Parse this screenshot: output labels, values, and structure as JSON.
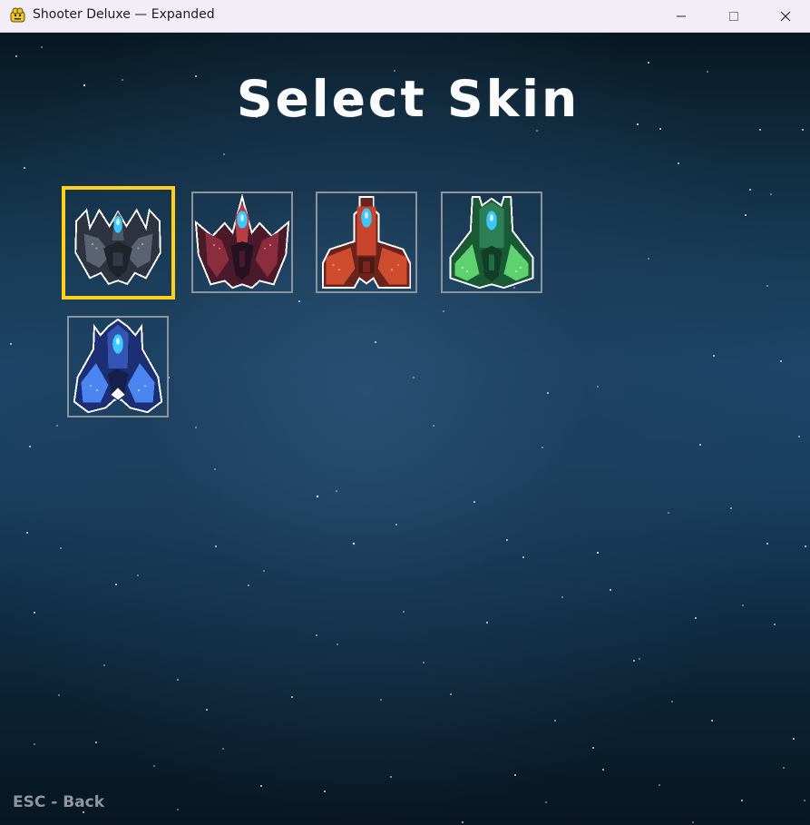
{
  "window": {
    "title": "Shooter Deluxe — Expanded",
    "app_icon": "pygame-snake-icon",
    "controls": {
      "minimize_icon": "minimize-icon",
      "maximize_icon": "maximize-icon",
      "close_icon": "close-icon"
    }
  },
  "screen": {
    "heading": "Select Skin",
    "hint": "ESC - Back",
    "selected_index": 0,
    "colors": {
      "selection_border": "#ffd11a",
      "tile_border": "#8f949b",
      "heading": "#fbfbfb",
      "hint": "#8f969e"
    }
  },
  "skins": [
    {
      "icon": "gray-fighter-ship-icon",
      "palette": [
        "#2b2f3a",
        "#5a6678",
        "#44c8ff"
      ]
    },
    {
      "icon": "crimson-fighter-ship-icon",
      "palette": [
        "#4a1f2b",
        "#8a2c3a",
        "#44c8ff"
      ]
    },
    {
      "icon": "orange-fighter-ship-icon",
      "palette": [
        "#6a2a1f",
        "#cc4b2d",
        "#44c8ff"
      ]
    },
    {
      "icon": "green-fighter-ship-icon",
      "palette": [
        "#1a5b33",
        "#52c86a",
        "#44c8ff"
      ]
    },
    {
      "icon": "blue-fighter-ship-icon",
      "palette": [
        "#1d2f73",
        "#4f8ef8",
        "#44c8ff"
      ]
    }
  ]
}
